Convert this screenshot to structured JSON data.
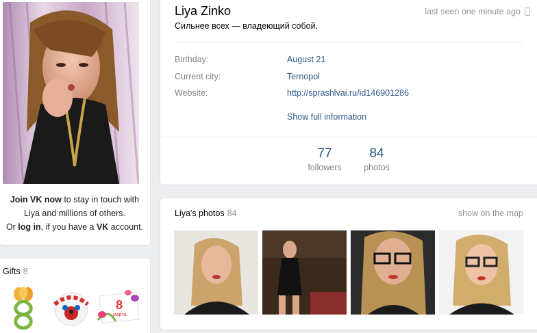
{
  "profile": {
    "name": "Liya Zinko",
    "last_seen": "last seen one minute ago",
    "status": "Сильнее всех — владеющий собой.",
    "info": [
      {
        "label": "Birthday:",
        "value": "August 21"
      },
      {
        "label": "Current city:",
        "value": "Ternopol"
      },
      {
        "label": "Website:",
        "value": "http://sprashlvai.ru/id146901286"
      }
    ],
    "show_full": "Show full information",
    "stats": [
      {
        "count": "77",
        "label": "followers"
      },
      {
        "count": "84",
        "label": "photos"
      }
    ]
  },
  "join": {
    "join_link": "Join VK now",
    "line1_rest": " to stay in touch with",
    "line2": "Liya and millions of others.",
    "line3_pre": "Or ",
    "login_link": "log in",
    "line3_mid": ", if you have a ",
    "vk": "VK",
    "line3_end": " account."
  },
  "gifts": {
    "title": "Gifts",
    "count": "8",
    "gift8_text": "8",
    "gift8_caption": "марта"
  },
  "photos": {
    "title": "Liya's photos",
    "count": "84",
    "map_link": "show on the map"
  },
  "colors": {
    "link": "#2a5885",
    "muted": "#828282",
    "page_bg": "#edeef0"
  },
  "icons": [
    "phone-icon"
  ]
}
